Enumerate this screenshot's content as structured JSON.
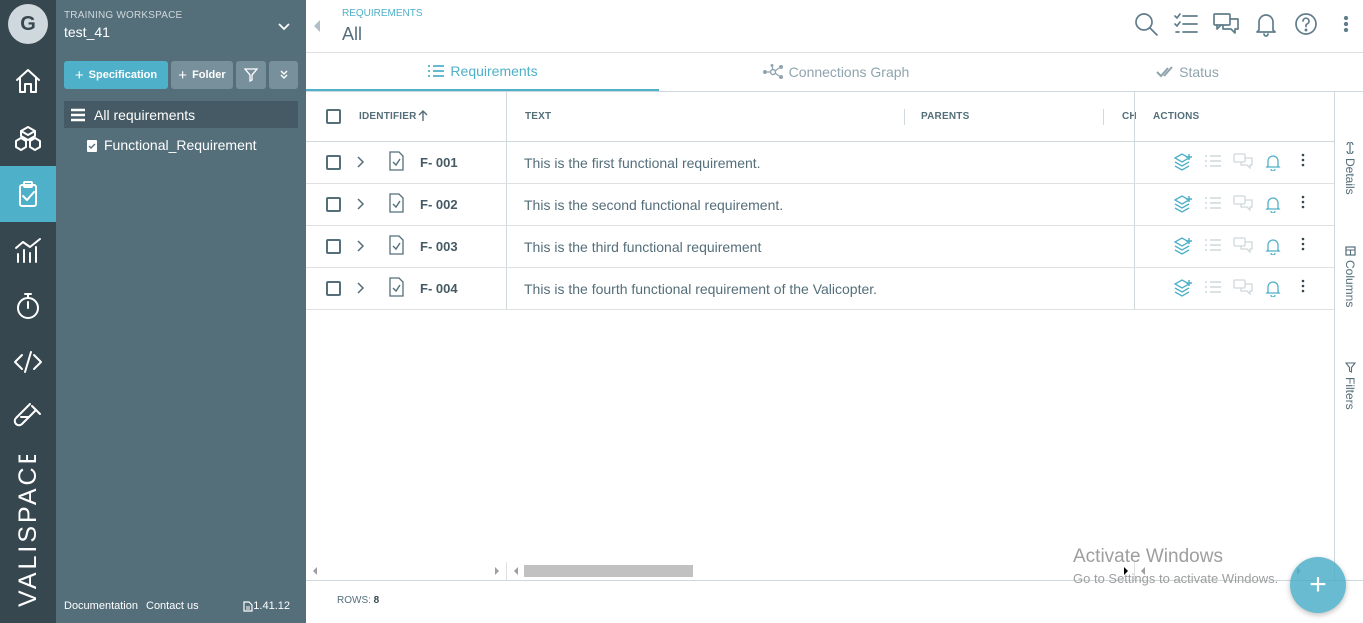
{
  "user": {
    "initial": "G"
  },
  "workspace": {
    "label": "TRAINING WORKSPACE",
    "name": "test_41"
  },
  "toolbar": {
    "specification_label": "Specification",
    "folder_label": "Folder"
  },
  "tree": {
    "all_label": "All requirements",
    "items": [
      {
        "label": "Functional_Requirement"
      }
    ]
  },
  "footer": {
    "documentation": "Documentation",
    "contact": "Contact us",
    "version": "1.41.12"
  },
  "brand": {
    "name": "VALISPACE"
  },
  "header": {
    "section": "REQUIREMENTS",
    "title": "All"
  },
  "tabs": [
    {
      "label": "Requirements",
      "icon": "list-icon",
      "active": true
    },
    {
      "label": "Connections Graph",
      "icon": "graph-icon",
      "active": false
    },
    {
      "label": "Status",
      "icon": "check-icon",
      "active": false
    }
  ],
  "grid": {
    "columns": {
      "identifier": "IDENTIFIER",
      "text": "TEXT",
      "parents": "PARENTS",
      "children": "CH",
      "actions": "ACTIONS"
    },
    "rows": [
      {
        "id": "F- 001",
        "text": "This is the first functional requirement."
      },
      {
        "id": "F- 002",
        "text": "This is the second functional requirement."
      },
      {
        "id": "F- 003",
        "text": "This is the third functional requirement"
      },
      {
        "id": "F- 004",
        "text": "This is the fourth functional requirement of the Valicopter."
      }
    ]
  },
  "side_panel": {
    "details": "Details",
    "columns": "Columns",
    "filters": "Filters"
  },
  "status": {
    "rows_label": "ROWS:",
    "rows_count": "8"
  },
  "watermark": {
    "line1": "Activate Windows",
    "line2": "Go to Settings to activate Windows."
  },
  "colors": {
    "accent": "#4eb0c9",
    "rail": "#37474f",
    "panel": "#546e7a"
  }
}
